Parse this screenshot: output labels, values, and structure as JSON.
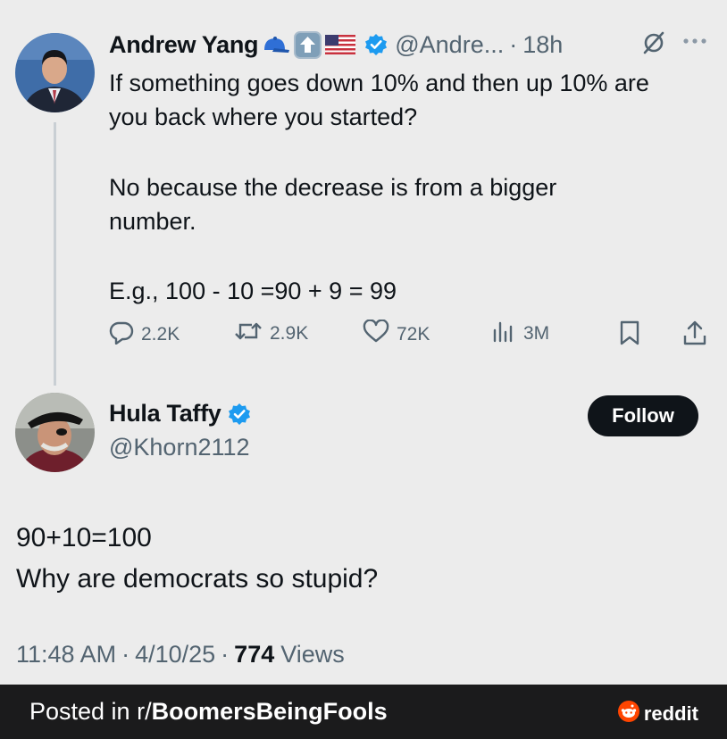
{
  "tweet": {
    "author_name": "Andrew Yang",
    "handle": "@Andre...",
    "separator": "·",
    "age": "18h",
    "text_lines": [
      "If something goes down 10% and then up 10% are",
      "you back where you started?",
      "No because the decrease is from a bigger",
      "number.",
      "E.g., 100 - 10 =90 + 9 = 99"
    ],
    "actions": {
      "replies": "2.2K",
      "reposts": "2.9K",
      "likes": "72K",
      "views": "3M"
    }
  },
  "reply": {
    "author_name": "Hula Taffy",
    "handle": "@Khorn2112",
    "follow_label": "Follow",
    "text_lines": [
      "90+10=100",
      "Why are democrats so stupid?"
    ],
    "meta": {
      "time": "11:48 AM",
      "sep": "·",
      "date": "4/10/25",
      "view_count": "774",
      "views_label": "Views"
    }
  },
  "footer": {
    "posted_prefix": "Posted in r/",
    "subreddit": "BoomersBeingFools",
    "brand": "reddit"
  },
  "icons": {
    "verified": "verified-badge-icon",
    "grok": "grok-icon",
    "more": "more-icon",
    "reply": "reply-icon",
    "repost": "repost-icon",
    "like": "heart-icon",
    "views": "views-icon",
    "bookmark": "bookmark-icon",
    "share": "share-icon",
    "reddit": "reddit-icon"
  },
  "colors": {
    "background": "#ececec",
    "verified_blue": "#1d9bf0",
    "muted": "#536471",
    "footer": "#1b1b1c"
  }
}
